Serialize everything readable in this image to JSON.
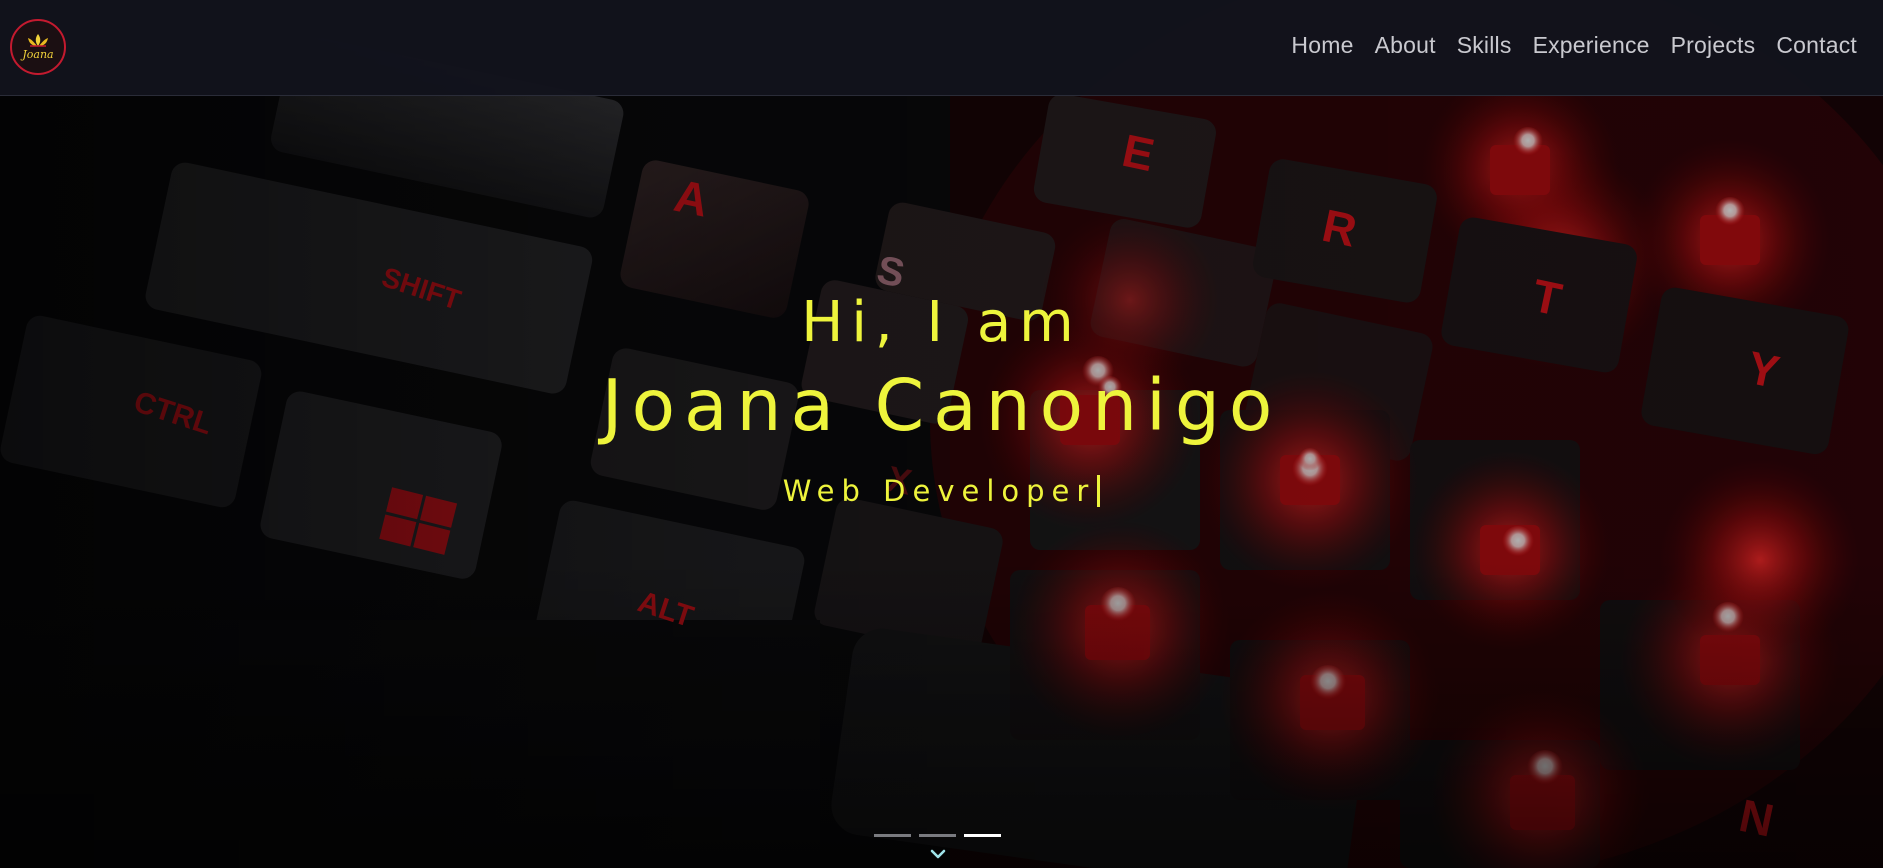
{
  "brand": {
    "logo_text": "Joana",
    "accent_color": "#c41a2f",
    "logo_text_color": "#f0d23a"
  },
  "nav": {
    "items": [
      {
        "label": "Home"
      },
      {
        "label": "About"
      },
      {
        "label": "Skills"
      },
      {
        "label": "Experience"
      },
      {
        "label": "Projects"
      },
      {
        "label": "Contact"
      }
    ]
  },
  "hero": {
    "greeting": "Hi, I am",
    "name": "Joana Canonigo",
    "role": "Web Developer",
    "text_color": "#eef43c",
    "background": "keyboard-photo"
  },
  "carousel": {
    "slide_count": 3,
    "active_index": 3,
    "scroll_icon": "chevron-down-icon"
  },
  "keycaps": [
    "SHIFT",
    "CTRL",
    "ALT",
    "A",
    "S",
    "X",
    "E",
    "R",
    "T",
    "Y",
    "N"
  ]
}
